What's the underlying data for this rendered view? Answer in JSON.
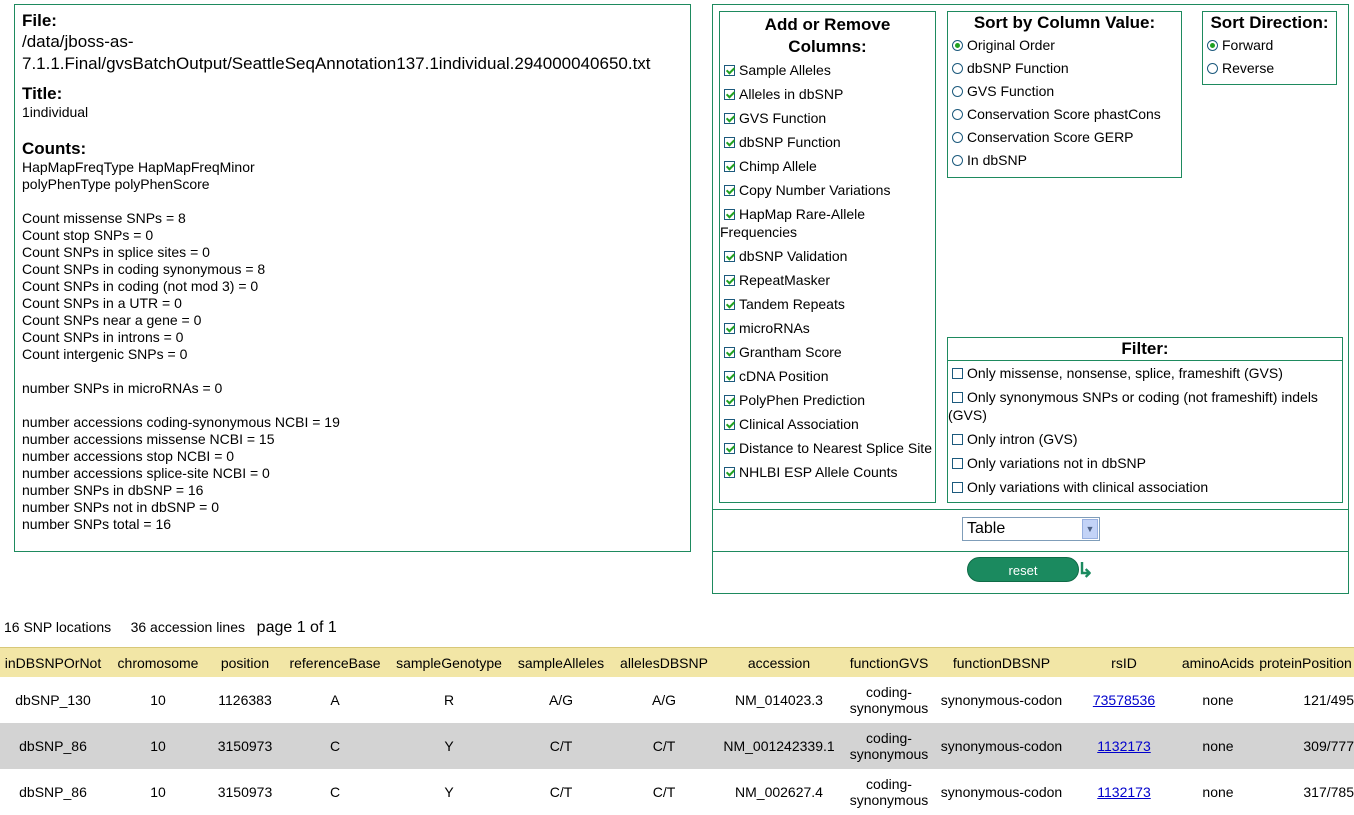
{
  "file": {
    "file_label": "File:",
    "path_line1": "/data/jboss-as-",
    "path_line2": "7.1.1.Final/gvsBatchOutput/SeattleSeqAnnotation137.1individual.294000040650.txt",
    "title_label": "Title:",
    "title_value": "1individual",
    "counts_label": "Counts:",
    "counts_lines_a": [
      "HapMapFreqType HapMapFreqMinor",
      "polyPhenType polyPhenScore"
    ],
    "counts_lines_b": [
      "Count missense SNPs = 8",
      "Count stop SNPs = 0",
      "Count SNPs in splice sites = 0",
      "Count SNPs in coding synonymous = 8",
      "Count SNPs in coding (not mod 3) = 0",
      "Count SNPs in a UTR = 0",
      "Count SNPs near a gene = 0",
      "Count SNPs in introns = 0",
      "Count intergenic SNPs = 0"
    ],
    "counts_lines_c": [
      "number SNPs in microRNAs = 0"
    ],
    "counts_lines_d": [
      "number accessions coding-synonymous NCBI = 19",
      "number accessions missense NCBI = 15",
      "number accessions stop NCBI = 0",
      "number accessions splice-site NCBI = 0",
      "number SNPs in dbSNP = 16",
      "number SNPs not in dbSNP = 0",
      "number SNPs total = 16"
    ]
  },
  "add_columns": {
    "header": "Add or Remove Columns:",
    "items": [
      {
        "label": "Sample Alleles",
        "checked": true
      },
      {
        "label": "Alleles in dbSNP",
        "checked": true
      },
      {
        "label": "GVS Function",
        "checked": true
      },
      {
        "label": "dbSNP Function",
        "checked": true
      },
      {
        "label": "Chimp Allele",
        "checked": true
      },
      {
        "label": "Copy Number Variations",
        "checked": true
      },
      {
        "label": "HapMap Rare-Allele Frequencies",
        "checked": true
      },
      {
        "label": "dbSNP Validation",
        "checked": true
      },
      {
        "label": "RepeatMasker",
        "checked": true
      },
      {
        "label": "Tandem Repeats",
        "checked": true
      },
      {
        "label": "microRNAs",
        "checked": true
      },
      {
        "label": "Grantham Score",
        "checked": true
      },
      {
        "label": "cDNA Position",
        "checked": true
      },
      {
        "label": "PolyPhen Prediction",
        "checked": true
      },
      {
        "label": "Clinical Association",
        "checked": true
      },
      {
        "label": "Distance to Nearest Splice Site",
        "checked": true
      },
      {
        "label": "NHLBI ESP Allele Counts",
        "checked": true
      }
    ]
  },
  "sort_column": {
    "header": "Sort by Column Value:",
    "options": [
      {
        "label": "Original Order",
        "selected": true
      },
      {
        "label": "dbSNP Function",
        "selected": false
      },
      {
        "label": "GVS Function",
        "selected": false
      },
      {
        "label": "Conservation Score phastCons",
        "selected": false
      },
      {
        "label": "Conservation Score GERP",
        "selected": false
      },
      {
        "label": "In dbSNP",
        "selected": false
      }
    ]
  },
  "sort_direction": {
    "header": "Sort Direction:",
    "options": [
      {
        "label": "Forward",
        "selected": true
      },
      {
        "label": "Reverse",
        "selected": false
      }
    ]
  },
  "filter": {
    "header": "Filter:",
    "items": [
      {
        "label": "Only missense, nonsense, splice, frameshift (GVS)",
        "checked": false
      },
      {
        "label": "Only synonymous SNPs or coding (not frameshift) indels (GVS)",
        "checked": false
      },
      {
        "label": "Only intron (GVS)",
        "checked": false
      },
      {
        "label": "Only variations not in dbSNP",
        "checked": false
      },
      {
        "label": "Only variations with clinical association",
        "checked": false
      }
    ]
  },
  "view_select": {
    "value": "Table"
  },
  "reset_label": "reset",
  "summary": {
    "snp_locations": "16 SNP locations",
    "accession_lines": "36 accession lines",
    "page": "page 1 of 1"
  },
  "table": {
    "columns": [
      "inDBSNPOrNot",
      "chromosome",
      "position",
      "referenceBase",
      "sampleGenotype",
      "sampleAlleles",
      "allelesDBSNP",
      "accession",
      "functionGVS",
      "functionDBSNP",
      "rsID",
      "aminoAcids",
      "proteinPosition"
    ],
    "rows": [
      [
        "dbSNP_130",
        "10",
        "1126383",
        "A",
        "R",
        "A/G",
        "A/G",
        "NM_014023.3",
        "coding-synonymous",
        "synonymous-codon",
        "73578536",
        "none",
        "121/495"
      ],
      [
        "dbSNP_86",
        "10",
        "3150973",
        "C",
        "Y",
        "C/T",
        "C/T",
        "NM_001242339.1",
        "coding-synonymous",
        "synonymous-codon",
        "1132173",
        "none",
        "309/777"
      ],
      [
        "dbSNP_86",
        "10",
        "3150973",
        "C",
        "Y",
        "C/T",
        "C/T",
        "NM_002627.4",
        "coding-synonymous",
        "synonymous-codon",
        "1132173",
        "none",
        "317/785"
      ]
    ]
  },
  "colors": {
    "border": "#1e8a5e",
    "header_row": "#f2e6a6",
    "alt_row": "#d3d3d3",
    "link": "#0000cc"
  }
}
